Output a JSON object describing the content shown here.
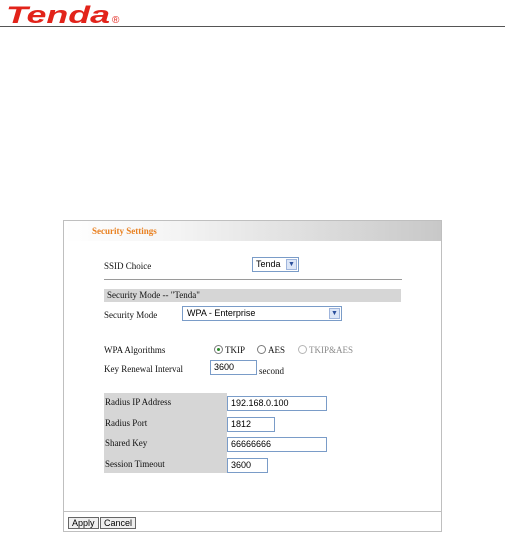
{
  "brand": {
    "logo_text": "Tenda",
    "registered_mark": "®",
    "color": "#e2231a"
  },
  "panel": {
    "title": "Security Settings",
    "title_color": "#e98020"
  },
  "ssid": {
    "label": "SSID Choice",
    "value": "Tenda"
  },
  "security": {
    "section_label": "Security Mode -- \"Tenda\"",
    "mode_label": "Security Mode",
    "mode_value": "WPA - Enterprise"
  },
  "wpa": {
    "label": "WPA Algorithms",
    "options": [
      {
        "label": "TKIP",
        "selected": true
      },
      {
        "label": "AES",
        "selected": false
      },
      {
        "label": "TKIP&AES",
        "selected": false
      }
    ],
    "renewal_label": "Key Renewal Interval",
    "renewal_value": "3600",
    "renewal_unit": "second"
  },
  "radius": {
    "ip_label": "Radius IP Address",
    "ip_value": "192.168.0.100",
    "port_label": "Radius Port",
    "port_value": "1812",
    "key_label": "Shared Key",
    "key_value": "66666666",
    "timeout_label": "Session Timeout",
    "timeout_value": "3600"
  },
  "buttons": {
    "apply": "Apply",
    "cancel": "Cancel"
  }
}
